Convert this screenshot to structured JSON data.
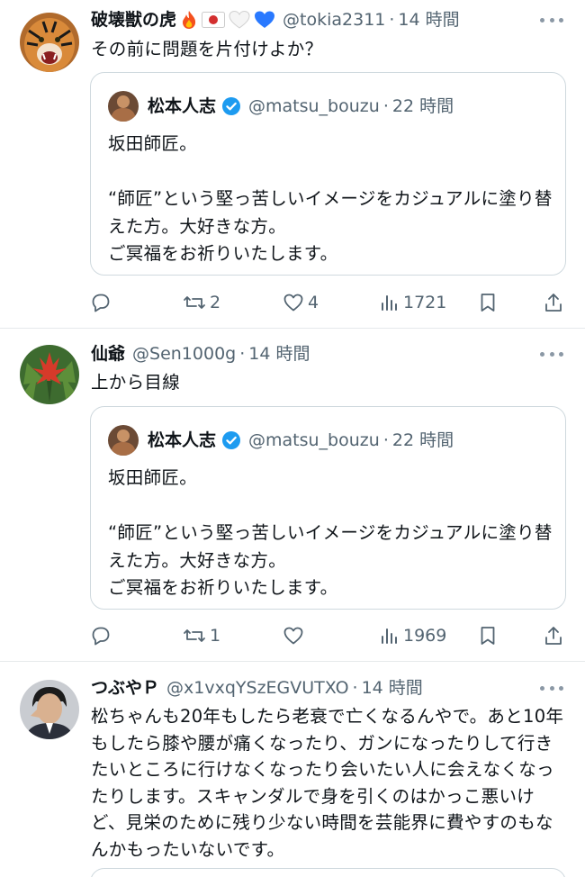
{
  "tweets": [
    {
      "name": "破壊獣の虎",
      "emojis": [
        "fire",
        "japan-flag",
        "white-heart",
        "blue-heart"
      ],
      "handle": "@tokia2311",
      "dot": "·",
      "time": "14 時間",
      "text": "その前に問題を片付けよか？",
      "quote": {
        "name": "松本人志",
        "handle": "@matsu_bouzu",
        "dot": "·",
        "time": "22 時間",
        "text": "坂田師匠。\n\n“師匠”という堅っ苦しいイメージをカジュアルに塗り替えた方。大好きな方。\nご冥福をお祈りいたします。"
      },
      "actions": {
        "replies": "",
        "retweets": "2",
        "likes": "4",
        "views": "1721"
      }
    },
    {
      "name": "仙爺",
      "handle": "@Sen1000g",
      "dot": "·",
      "time": "14 時間",
      "text": "上から目線",
      "quote": {
        "name": "松本人志",
        "handle": "@matsu_bouzu",
        "dot": "·",
        "time": "22 時間",
        "text": "坂田師匠。\n\n“師匠”という堅っ苦しいイメージをカジュアルに塗り替えた方。大好きな方。\nご冥福をお祈りいたします。"
      },
      "actions": {
        "replies": "",
        "retweets": "1",
        "likes": "",
        "views": "1969"
      }
    },
    {
      "name": "つぶやＰ",
      "handle": "@x1vxqYSzEGVUTXO",
      "dot": "·",
      "time": "14 時間",
      "text": "松ちゃんも20年もしたら老衰で亡くなるんやで。あと10年もしたら膝や腰が痛くなったり、ガンになったりして行きたいところに行けなくなったり会いたい人に会えなくなったりします。スキャンダルで身を引くのはかっこ悪いけど、見栄のために残り少ない時間を芸能界に費やすのもなんかもったいないです。"
    }
  ],
  "colors": {
    "text": "#0f1419",
    "muted": "#536471",
    "border": "#cfd9de",
    "verified": "#1d9bf0"
  }
}
